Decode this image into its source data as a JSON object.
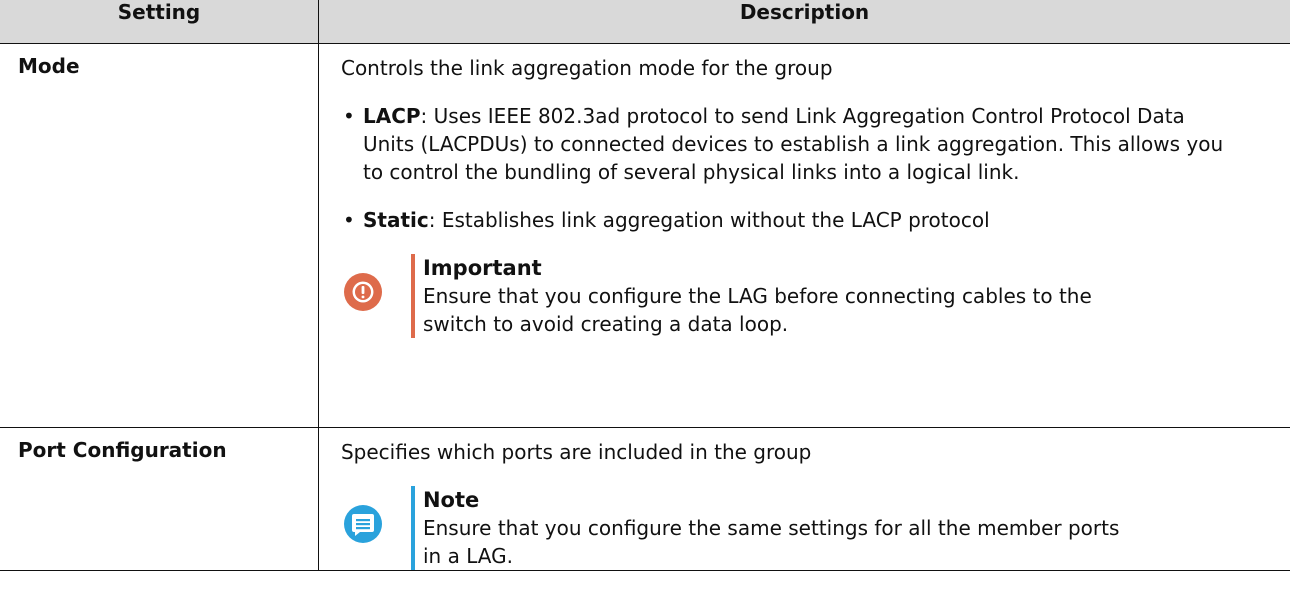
{
  "table": {
    "headers": [
      "Setting",
      "Description"
    ],
    "rows": [
      {
        "setting": "Mode",
        "description": "Controls the link aggregation mode for the group",
        "bullets": [
          {
            "term": "LACP",
            "text": ": Uses IEEE 802.3ad protocol to send Link Aggregation Control Protocol Data Units (LACPDUs) to connected devices to establish a link aggregation. This allows you to control the bundling of several physical links into a logical link."
          },
          {
            "term": "Static",
            "text": ": Establishes link aggregation without the LACP protocol"
          }
        ],
        "callout": {
          "type": "important",
          "icon": "exclamation-icon",
          "title": "Important",
          "text": "Ensure that you configure the LAG before connecting cables to the switch to avoid creating a data loop.",
          "color": "#de6b4b"
        }
      },
      {
        "setting": "Port Configuration",
        "description": "Specifies which ports are included in the group",
        "callout": {
          "type": "note",
          "icon": "note-icon",
          "title": "Note",
          "text": "Ensure that you configure the same settings for all the member ports in a LAG.",
          "color": "#2aa2dc"
        }
      }
    ]
  },
  "colors": {
    "header_bg": "#d9d9d9",
    "important_accent": "#de6b4b",
    "note_accent": "#2aa2dc"
  }
}
